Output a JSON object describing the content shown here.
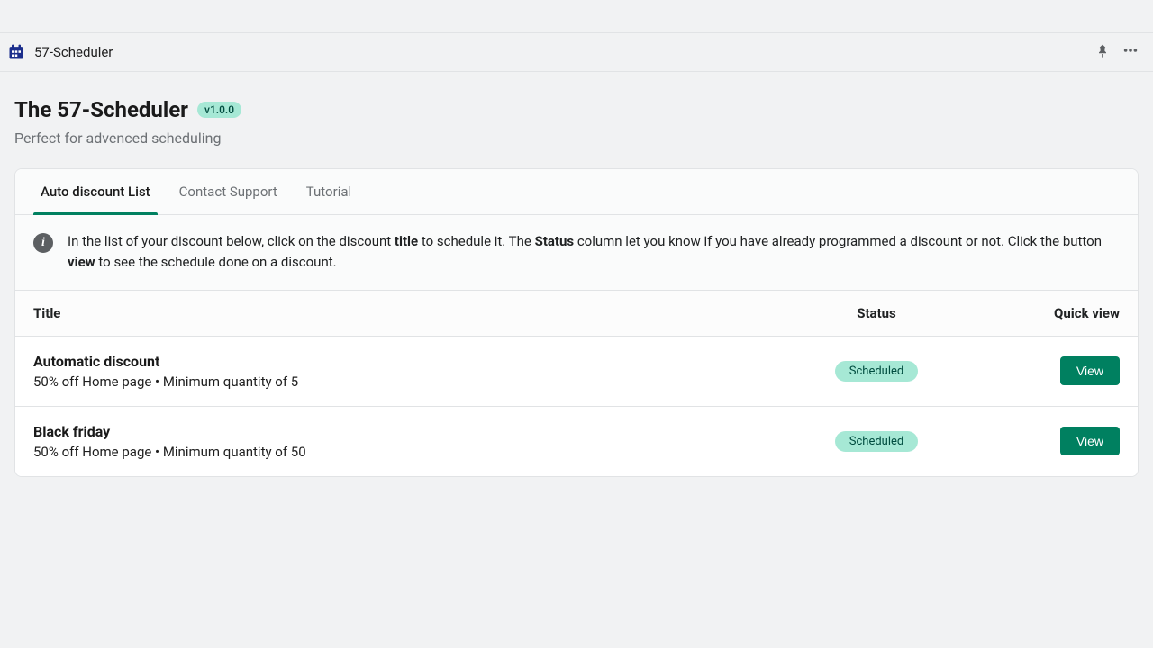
{
  "topbar": {
    "app_name": "57-Scheduler"
  },
  "header": {
    "title": "The 57-Scheduler",
    "version": "v1.0.0",
    "subtitle": "Perfect for advenced scheduling"
  },
  "tabs": [
    {
      "label": "Auto discount List"
    },
    {
      "label": "Contact Support"
    },
    {
      "label": "Tutorial"
    }
  ],
  "info": {
    "prefix": "In the list of your discount below, click on the discount ",
    "bold1": "title",
    "mid1": " to schedule it. The ",
    "bold2": "Status",
    "mid2": " column let you know if you have already programmed a discount or not. Click the button ",
    "bold3": "view",
    "suffix": " to see the schedule done on a discount."
  },
  "table": {
    "headers": {
      "title": "Title",
      "status": "Status",
      "action": "Quick view"
    },
    "rows": [
      {
        "title": "Automatic discount",
        "subtitle": "50% off Home page • Minimum quantity of 5",
        "status": "Scheduled",
        "action": "View"
      },
      {
        "title": "Black friday",
        "subtitle": "50% off Home page • Minimum quantity of 50",
        "status": "Scheduled",
        "action": "View"
      }
    ]
  }
}
